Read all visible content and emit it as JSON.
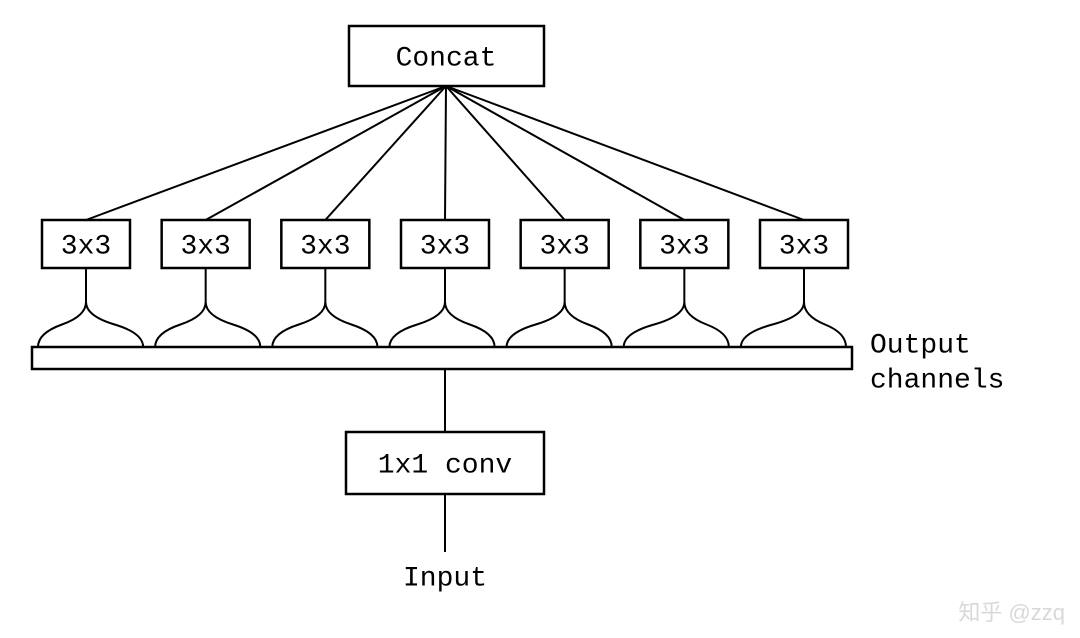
{
  "diagram": {
    "concat": "Concat",
    "conv_nodes": [
      "3x3",
      "3x3",
      "3x3",
      "3x3",
      "3x3",
      "3x3",
      "3x3"
    ],
    "output_channels_line1": "Output",
    "output_channels_line2": "channels",
    "bottleneck": "1x1 conv",
    "input": "Input"
  },
  "watermark": "知乎 @zzq"
}
